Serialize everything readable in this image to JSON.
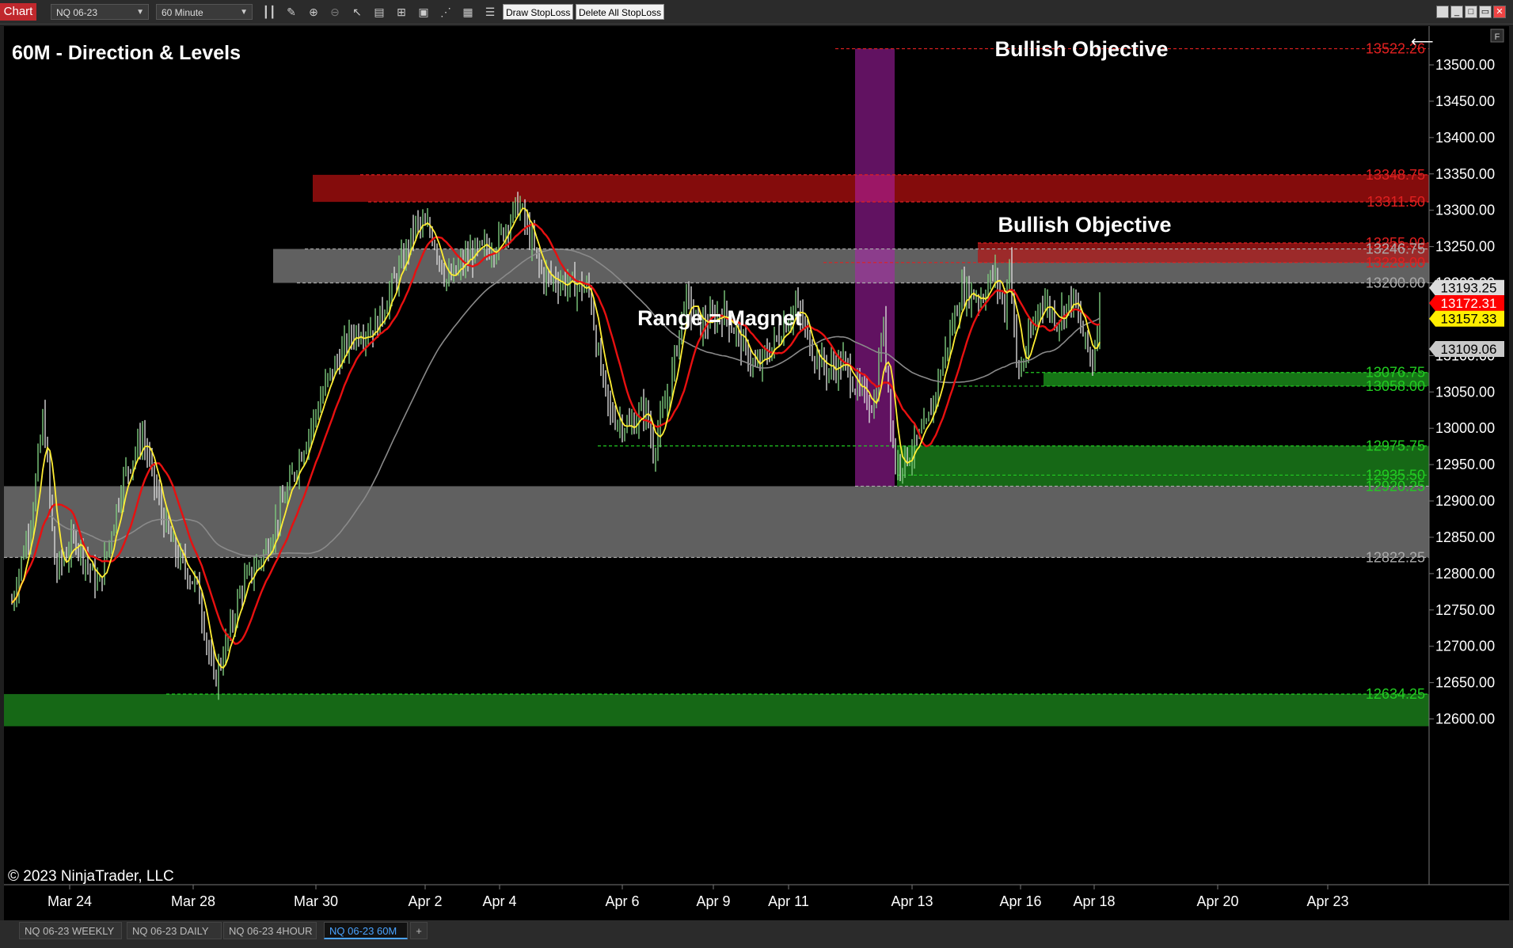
{
  "toolbar": {
    "chart_label": "Chart",
    "instrument": "NQ 06-23",
    "timeframe": "60 Minute",
    "draw_stoploss": "Draw StopLoss",
    "delete_stoploss": "Delete All StopLoss",
    "icons": [
      "bar-style-icon",
      "pencil-icon",
      "zoom-in-icon",
      "zoom-out-icon",
      "cursor-icon",
      "properties-icon",
      "data-box-icon",
      "indicators-icon",
      "strategies-icon",
      "templates-icon",
      "list-icon"
    ],
    "panel_flag": "F"
  },
  "chart": {
    "title": "60M - Direction & Levels",
    "copyright": "© 2023 NinjaTrader, LLC",
    "annotations": {
      "bullish_top": "Bullish Objective",
      "bullish_mid": "Bullish Objective",
      "range": "Range = Magnet"
    },
    "level_labels": [
      {
        "text": "13522.26",
        "price": 13522.26,
        "color": "#e02020"
      },
      {
        "text": "13348.75",
        "price": 13348.75,
        "color": "#e02020"
      },
      {
        "text": "13311.50",
        "price": 13311.5,
        "color": "#e02020"
      },
      {
        "text": "13255.00",
        "price": 13255.0,
        "color": "#e02020"
      },
      {
        "text": "13246.75",
        "price": 13246.75,
        "color": "#aaaaaa"
      },
      {
        "text": "13228.00",
        "price": 13228.0,
        "color": "#e02020"
      },
      {
        "text": "13200.00",
        "price": 13200.0,
        "color": "#aaaaaa"
      },
      {
        "text": "13076.75",
        "price": 13076.75,
        "color": "#22cc22"
      },
      {
        "text": "13058.00",
        "price": 13058.0,
        "color": "#22cc22"
      },
      {
        "text": "12975.75",
        "price": 12975.75,
        "color": "#22cc22"
      },
      {
        "text": "12935.50",
        "price": 12935.5,
        "color": "#22cc22"
      },
      {
        "text": "12920.25",
        "price": 12920.25,
        "color": "#22cc22"
      },
      {
        "text": "12822.25",
        "price": 12822.25,
        "color": "#aaaaaa"
      },
      {
        "text": "12634.25",
        "price": 12634.25,
        "color": "#22cc22"
      }
    ],
    "price_ticks": [
      "13500.00",
      "13450.00",
      "13400.00",
      "13350.00",
      "13300.00",
      "13250.00",
      "13200.00",
      "13150.00",
      "13100.00",
      "13050.00",
      "13000.00",
      "12950.00",
      "12900.00",
      "12850.00",
      "12800.00",
      "12750.00",
      "12700.00",
      "12650.00",
      "12600.00"
    ],
    "price_tick_values": [
      13500,
      13450,
      13400,
      13350,
      13300,
      13250,
      13200,
      13150,
      13100,
      13050,
      13000,
      12950,
      12900,
      12850,
      12800,
      12750,
      12700,
      12650,
      12600
    ],
    "price_markers": [
      {
        "text": "13193.25",
        "price": 13193.25,
        "bg": "#dcdcdc",
        "fg": "#000000"
      },
      {
        "text": "13172.31",
        "price": 13172.31,
        "bg": "#ff0000",
        "fg": "#ffffff"
      },
      {
        "text": "13157.33",
        "price": 13157.33,
        "bg": "#ffee00",
        "fg": "#000000"
      },
      {
        "text": "13109.06",
        "price": 13109.06,
        "bg": "#c8c8c8",
        "fg": "#000000"
      }
    ],
    "date_ticks": [
      "Mar 24",
      "Mar 28",
      "Mar 30",
      "Apr 2",
      "Apr 4",
      "Apr 6",
      "Apr 9",
      "Apr 11",
      "Apr 13",
      "Apr 16",
      "Apr 18",
      "Apr 20",
      "Apr 23"
    ],
    "colors": {
      "sma_fast": "#ffee33",
      "sma_mid": "#e81010",
      "sma_slow": "#8a8a8a",
      "up_bar": "#7ecb7e",
      "down_bar": "#d8d8d8"
    }
  },
  "bottom_tabs": [
    {
      "label": "NQ 06-23 WEEKLY",
      "active": false
    },
    {
      "label": "NQ 06-23 DAILY",
      "active": false
    },
    {
      "label": "NQ 06-23 4HOUR",
      "active": false
    },
    {
      "label": "NQ 06-23 60M",
      "active": true
    }
  ],
  "add_tab": "+"
}
